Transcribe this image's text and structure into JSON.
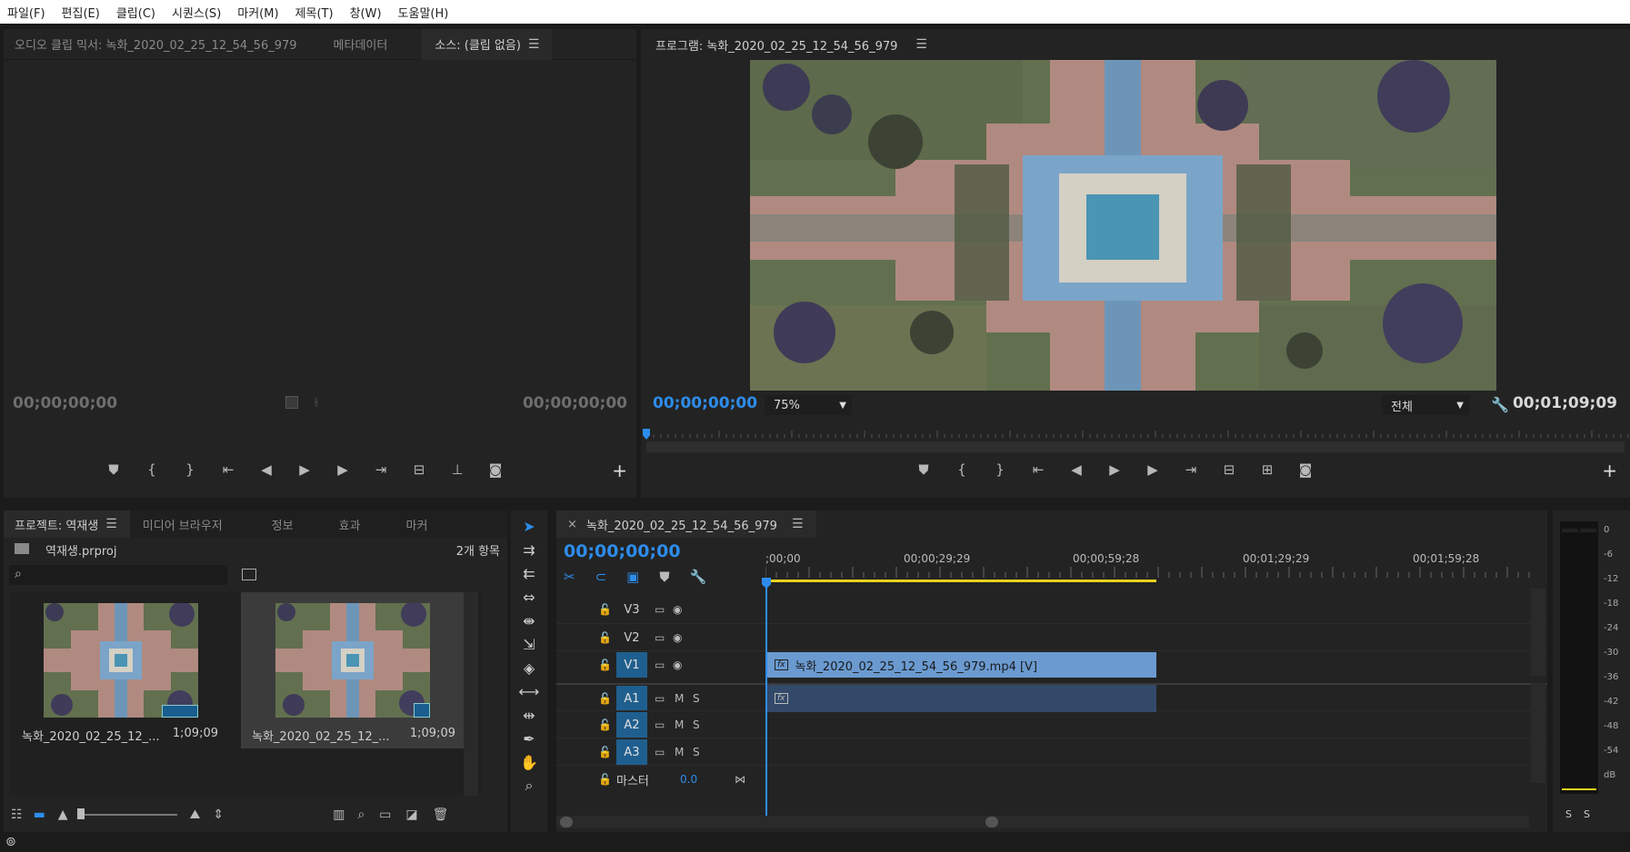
{
  "menu": [
    "파일(F)",
    "편집(E)",
    "클립(C)",
    "시퀀스(S)",
    "마커(M)",
    "제목(T)",
    "창(W)",
    "도움말(H)"
  ],
  "source_panel": {
    "tabs": [
      "오디오 클립 믹서: 녹화_2020_02_25_12_54_56_979",
      "메타데이터",
      "소스: (클립 없음)"
    ],
    "tc_left": "00;00;00;00",
    "tc_right": "00;00;00;00"
  },
  "program_panel": {
    "title": "프로그램: 녹화_2020_02_25_12_54_56_979",
    "tc_current": "00;00;00;00",
    "zoom": "75%",
    "quality": "전체",
    "tc_duration": "00;01;09;09"
  },
  "project_panel": {
    "tabs": [
      "프로젝트: 역재생",
      "미디어 브라우저",
      "정보",
      "효과",
      "마커"
    ],
    "project_file": "역재생.prproj",
    "item_count": "2개 항목",
    "search_placeholder": "",
    "items": [
      {
        "name": "녹화_2020_02_25_12_...",
        "duration": "1;09;09"
      },
      {
        "name": "녹화_2020_02_25_12_...",
        "duration": "1;09;09"
      }
    ]
  },
  "timeline": {
    "tab": "녹화_2020_02_25_12_54_56_979",
    "tc_current": "00;00;00;00",
    "ruler": [
      ";00;00",
      "00;00;29;29",
      "00;00;59;28",
      "00;01;29;29",
      "00;01;59;28"
    ],
    "video_tracks": [
      "V3",
      "V2",
      "V1"
    ],
    "audio_tracks": [
      "A1",
      "A2",
      "A3"
    ],
    "master_label": "마스터",
    "master_value": "0.0",
    "clip_label": "녹화_2020_02_25_12_54_56_979.mp4 [V]",
    "fx": "fx",
    "m": "M",
    "s": "S"
  },
  "meter": {
    "labels": [
      "0",
      "-6",
      "-12",
      "-18",
      "-24",
      "-30",
      "-36",
      "-42",
      "-48",
      "-54",
      "dB"
    ],
    "solo": [
      "S",
      "S"
    ]
  },
  "colors": {
    "accent": "#2d8ceb",
    "clip_video": "#6a9ad0",
    "clip_audio": "#33496a",
    "work_area": "#e6d21e"
  }
}
